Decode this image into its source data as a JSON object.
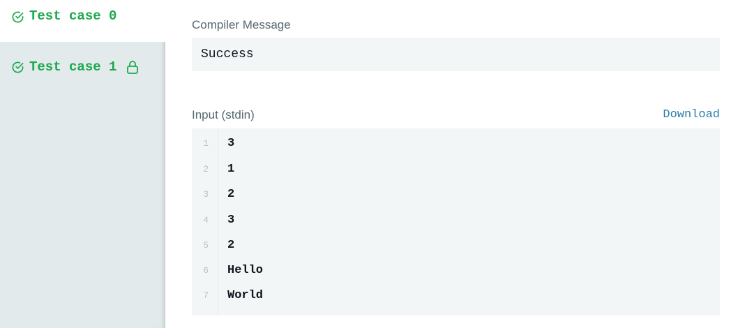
{
  "sidebar": {
    "test_cases": [
      {
        "label": "Test case 0",
        "status": "passed",
        "active": true,
        "locked": false
      },
      {
        "label": "Test case 1",
        "status": "passed",
        "active": false,
        "locked": true
      }
    ]
  },
  "compiler": {
    "label": "Compiler Message",
    "message": "Success"
  },
  "input": {
    "label": "Input (stdin)",
    "download_label": "Download",
    "lines": [
      {
        "num": "1",
        "text": "3"
      },
      {
        "num": "2",
        "text": "1"
      },
      {
        "num": "3",
        "text": "2"
      },
      {
        "num": "4",
        "text": "3"
      },
      {
        "num": "5",
        "text": "2"
      },
      {
        "num": "6",
        "text": "Hello"
      },
      {
        "num": "7",
        "text": "World"
      }
    ]
  },
  "colors": {
    "success_green": "#1ba94c",
    "link_blue": "#2a7fa9",
    "sidebar_bg": "#e3eaec",
    "box_bg": "#f3f6f6"
  },
  "icons": {
    "check": "check-circle-icon",
    "lock": "lock-icon"
  }
}
